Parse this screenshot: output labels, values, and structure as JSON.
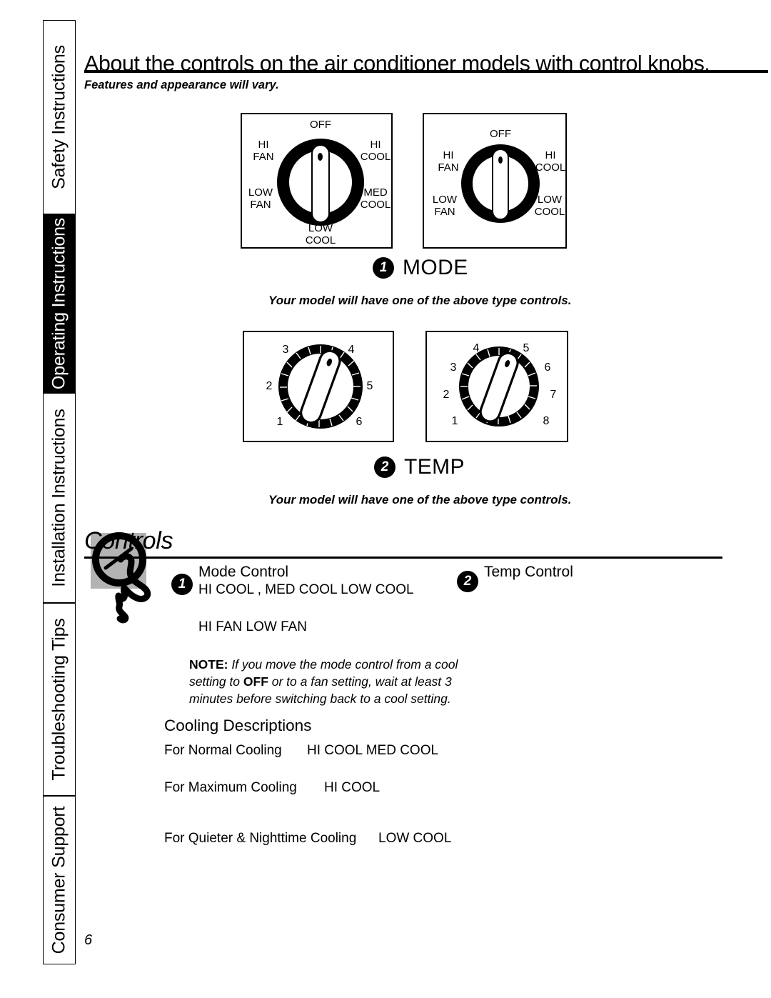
{
  "sidebar": {
    "tabs": [
      {
        "label": "Safety Instructions",
        "active": false
      },
      {
        "label": "Operating Instructions",
        "active": true
      },
      {
        "label": "Installation Instructions",
        "active": false
      },
      {
        "label": "Troubleshooting Tips",
        "active": false
      },
      {
        "label": "Consumer Support",
        "active": false
      }
    ]
  },
  "header": {
    "title": "About the controls on the air conditioner models with control knobs.",
    "subtitle": "Features and appearance will vary."
  },
  "mode_section": {
    "badge": "1",
    "label": "MODE",
    "caption": "Your model will have one of the above type controls.",
    "dials": [
      {
        "name": "mode-dial-a",
        "labels": [
          {
            "text": "OFF",
            "pos": "top"
          },
          {
            "text": "HI\nFAN",
            "pos": "upper-left"
          },
          {
            "text": "HI\nCOOL",
            "pos": "upper-right"
          },
          {
            "text": "LOW\nFAN",
            "pos": "lower-left"
          },
          {
            "text": "MED\nCOOL",
            "pos": "lower-right"
          },
          {
            "text": "LOW\nCOOL",
            "pos": "bottom"
          }
        ]
      },
      {
        "name": "mode-dial-b",
        "labels": [
          {
            "text": "OFF",
            "pos": "top"
          },
          {
            "text": "HI\nFAN",
            "pos": "upper-left"
          },
          {
            "text": "HI\nCOOL",
            "pos": "upper-right"
          },
          {
            "text": "LOW\nFAN",
            "pos": "lower-left"
          },
          {
            "text": "LOW\nCOOL",
            "pos": "lower-right"
          }
        ]
      }
    ]
  },
  "temp_section": {
    "badge": "2",
    "label": "TEMP",
    "caption": "Your model will have one of the above type controls.",
    "dials": [
      {
        "name": "temp-dial-6",
        "numbers": [
          "1",
          "2",
          "3",
          "4",
          "5",
          "6"
        ]
      },
      {
        "name": "temp-dial-8",
        "numbers": [
          "1",
          "2",
          "3",
          "4",
          "5",
          "6",
          "7",
          "8"
        ]
      }
    ]
  },
  "controls": {
    "heading": "Controls",
    "mode_control": {
      "badge": "1",
      "title": "Mode Control",
      "line1": "HI COOL , MED COOL LOW COOL",
      "line2": "HI FAN       LOW FAN"
    },
    "temp_control": {
      "badge": "2",
      "title": "Temp Control"
    },
    "note": {
      "lead": "NOTE:",
      "body_1": " If you move the mode control from a cool setting to ",
      "emph": "OFF",
      "body_2": " or to a fan setting, wait at least 3 minutes before switching back to a cool setting."
    },
    "cooling": {
      "title": "Cooling Descriptions",
      "rows": [
        {
          "label": "For Normal Cooling",
          "value": "HI COOL   MED COOL"
        },
        {
          "label": "For Maximum Cooling",
          "value": "HI COOL"
        },
        {
          "label": "For Quieter & Nighttime Cooling",
          "value": "LOW COOL"
        }
      ]
    }
  },
  "footer": {
    "page_number": "6"
  },
  "colors": {
    "ink": "#000000",
    "paper": "#ffffff",
    "icon_panel": "#b3b3b3",
    "active_tab_bg": "#000000"
  }
}
